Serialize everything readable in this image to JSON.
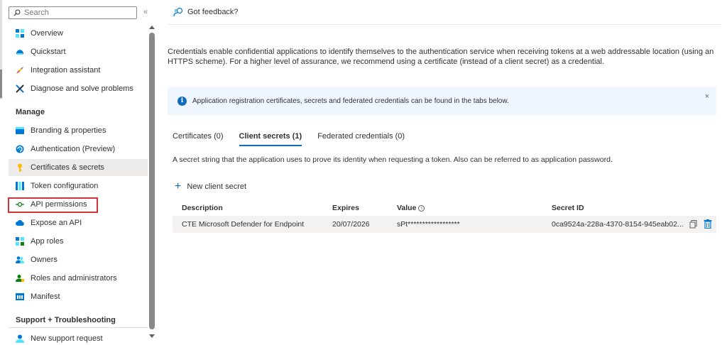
{
  "sidebar": {
    "search_placeholder": "Search",
    "collapse_glyph": "«",
    "items_top": [
      {
        "label": "Overview",
        "icon": "overview-icon"
      },
      {
        "label": "Quickstart",
        "icon": "quickstart-icon"
      },
      {
        "label": "Integration assistant",
        "icon": "rocket-icon"
      },
      {
        "label": "Diagnose and solve problems",
        "icon": "wrench-icon"
      }
    ],
    "manage_label": "Manage",
    "manage_items": [
      {
        "label": "Branding & properties",
        "icon": "branding-icon"
      },
      {
        "label": "Authentication (Preview)",
        "icon": "authentication-icon"
      },
      {
        "label": "Certificates & secrets",
        "icon": "key-icon"
      },
      {
        "label": "Token configuration",
        "icon": "token-icon"
      },
      {
        "label": "API permissions",
        "icon": "api-permissions-icon"
      },
      {
        "label": "Expose an API",
        "icon": "cloud-icon"
      },
      {
        "label": "App roles",
        "icon": "app-roles-icon"
      },
      {
        "label": "Owners",
        "icon": "owners-icon"
      },
      {
        "label": "Roles and administrators",
        "icon": "roles-icon"
      },
      {
        "label": "Manifest",
        "icon": "manifest-icon"
      }
    ],
    "support_label": "Support + Troubleshooting",
    "support_items": [
      {
        "label": "New support request",
        "icon": "support-icon"
      }
    ],
    "selected": "Certificates & secrets",
    "highlighted": "API permissions"
  },
  "main": {
    "feedback_label": "Got feedback?",
    "intro_text": "Credentials enable confidential applications to identify themselves to the authentication service when receiving tokens at a web addressable location (using an HTTPS scheme). For a higher level of assurance, we recommend using a certificate (instead of a client secret) as a credential.",
    "info_banner": "Application registration certificates, secrets and federated credentials can be found in the tabs below.",
    "info_close": "×",
    "tabs": [
      {
        "label": "Certificates (0)"
      },
      {
        "label": "Client secrets (1)"
      },
      {
        "label": "Federated credentials (0)"
      }
    ],
    "active_tab": "Client secrets (1)",
    "tab_description": "A secret string that the application uses to prove its identity when requesting a token. Also can be referred to as application password.",
    "new_secret_label": "New client secret",
    "table": {
      "headers": [
        "Description",
        "Expires",
        "Value",
        "Secret ID"
      ],
      "rows": [
        {
          "description": "CTE Microsoft Defender for Endpoint",
          "expires": "20/07/2026",
          "value": "sPt******************",
          "secret_id": "0ca9524a-228a-4370-8154-945eab02..."
        }
      ]
    }
  },
  "colors": {
    "accent": "#0f6cbd",
    "highlight_box": "#d13438",
    "selected_bg": "#edebe9",
    "info_bg": "#f0f6ff"
  }
}
